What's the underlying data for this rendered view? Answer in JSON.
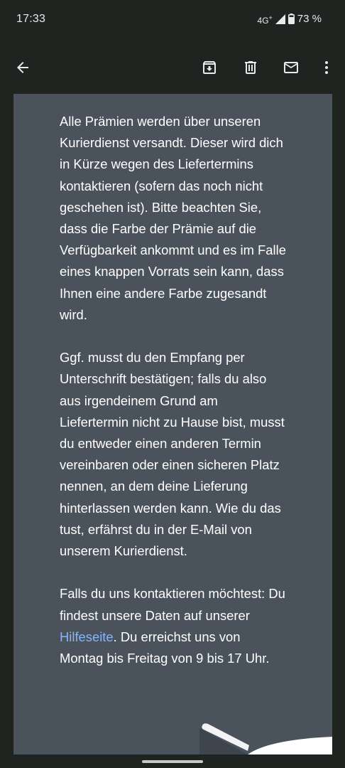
{
  "status_bar": {
    "time": "17:33",
    "network": "4G",
    "network_plus": "+",
    "battery": "73 %"
  },
  "app_bar": {
    "icons": [
      "back-arrow-icon",
      "archive-icon",
      "delete-icon",
      "mail-icon",
      "more-vert-icon"
    ]
  },
  "email": {
    "para1": "Alle Prämien werden über unseren Kurierdienst versandt. Dieser wird dich in Kürze wegen des Liefertermins kontaktieren (sofern das noch nicht geschehen ist). Bitte beachten Sie, dass die Farbe der Prämie auf die Verfügbarkeit ankommt und es im Falle eines knappen Vorrats sein kann, dass Ihnen eine andere Farbe zugesandt wird.",
    "para2": "Ggf. musst du den Empfang per Unterschrift bestätigen; falls du also aus irgendeinem Grund am Liefertermin nicht zu Hause bist, musst du entweder einen anderen Termin vereinbaren oder einen sicheren Platz nennen, an dem deine Lieferung hinterlassen werden kann. Wie du das tust, erfährst du in der E-Mail von unserem Kurierdienst.",
    "para3_before": "Falls du uns kontaktieren möchtest: Du findest unsere Daten auf unserer ",
    "para3_link": "Hilfeseite",
    "para3_after": ". Du erreichst uns von Montag bis Freitag von 9 bis 17 Uhr."
  },
  "colors": {
    "background": "#1f2421",
    "email_background": "#4a525b",
    "link": "#8ab4f8"
  }
}
